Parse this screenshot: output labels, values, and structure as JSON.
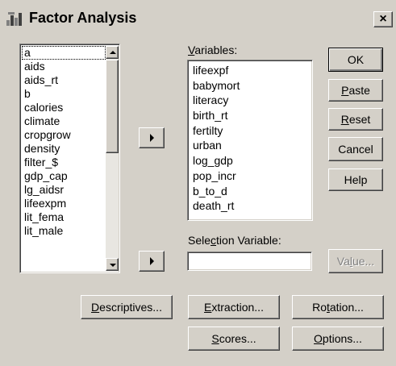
{
  "window": {
    "title": "Factor Analysis",
    "close_label": "×"
  },
  "source_list": {
    "items": [
      "a",
      "aids",
      "aids_rt",
      "b",
      "calories",
      "climate",
      "cropgrow",
      "density",
      "filter_$",
      "gdp_cap",
      "lg_aidsr",
      "lifeexpm",
      "lit_fema",
      "lit_male"
    ],
    "focused_index": 0
  },
  "variables": {
    "label_mnemonic": "V",
    "label_rest": "ariables:",
    "items": [
      "lifeexpf",
      "babymort",
      "literacy",
      "birth_rt",
      "fertilty",
      "urban",
      "log_gdp",
      "pop_incr",
      "b_to_d",
      "death_rt"
    ]
  },
  "selection": {
    "label_pre": "Sele",
    "label_mnemonic": "c",
    "label_post": "tion Variable:",
    "value": ""
  },
  "buttons": {
    "ok": "OK",
    "paste_m": "P",
    "paste_r": "aste",
    "reset_m": "R",
    "reset_r": "eset",
    "cancel": "Cancel",
    "help": "Help",
    "value_pre": "Va",
    "value_m": "l",
    "value_post": "ue...",
    "descriptives_m": "D",
    "descriptives_r": "escriptives...",
    "extraction_m": "E",
    "extraction_r": "xtraction...",
    "rotation_pre": "Ro",
    "rotation_m": "t",
    "rotation_post": "ation...",
    "scores_m": "S",
    "scores_r": "cores...",
    "options_m": "O",
    "options_r": "ptions..."
  }
}
